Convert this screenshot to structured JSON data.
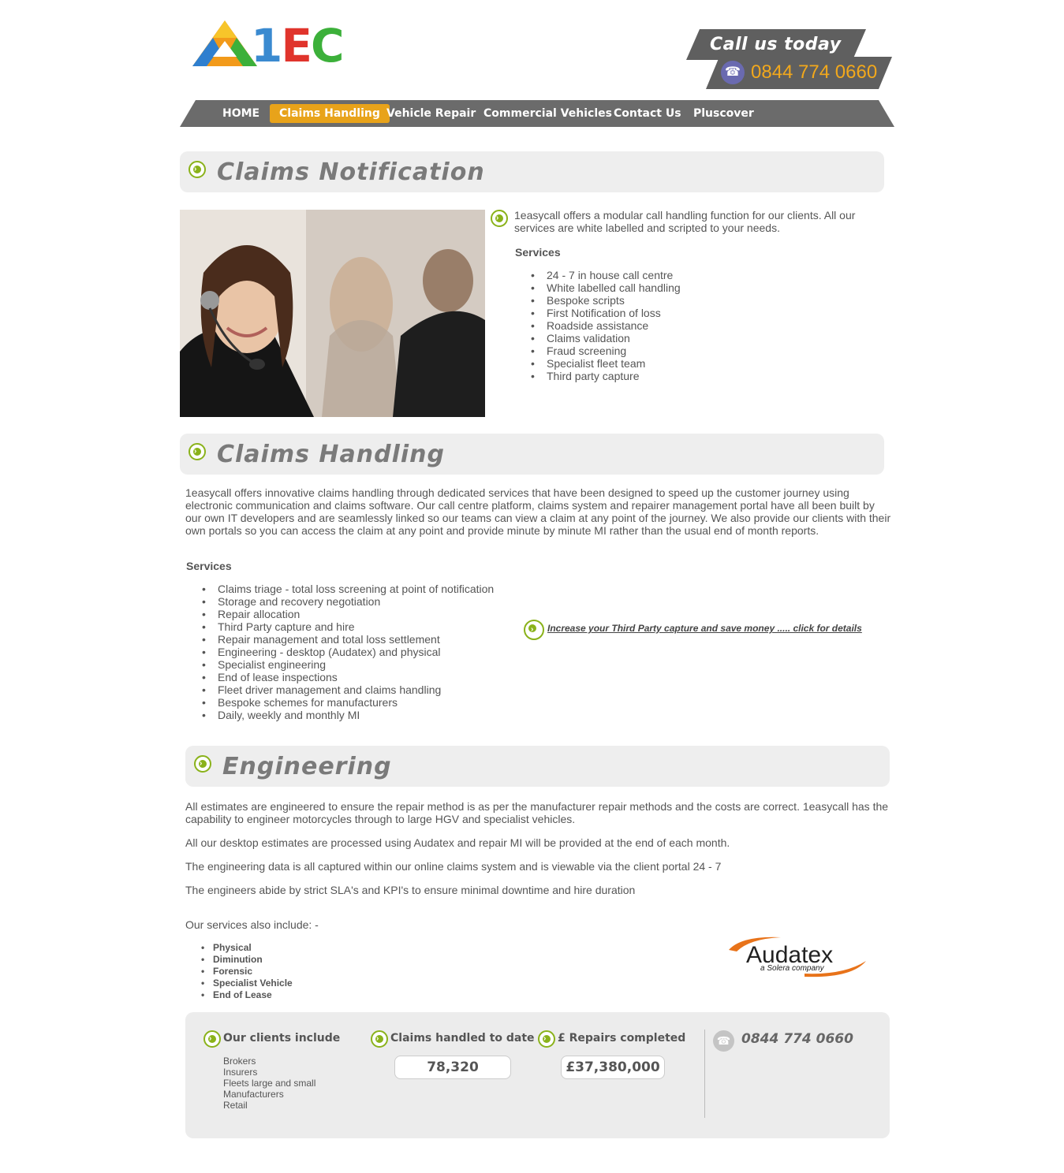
{
  "header": {
    "logo_text": {
      "one": "1",
      "e": "E",
      "c": "C"
    },
    "call_label": "Call us today",
    "phone": "0844 774 0660"
  },
  "nav": {
    "items": [
      {
        "label": "HOME"
      },
      {
        "label": "Claims Handling",
        "active": true
      },
      {
        "label": "Vehicle Repair"
      },
      {
        "label": "Commercial Vehicles"
      },
      {
        "label": "Contact Us"
      },
      {
        "label": "Pluscover"
      }
    ]
  },
  "claims_notification": {
    "title": "Claims Notification",
    "intro": "1easycall offers a modular call handling function for our clients. All our services are white labelled and scripted to your needs.",
    "services_label": "Services",
    "services": [
      "24 - 7 in house call centre",
      "White labelled call handling",
      "Bespoke scripts",
      "First Notification of loss",
      "Roadside assistance",
      "Claims validation",
      "Fraud screening",
      "Specialist fleet team",
      "Third party capture"
    ]
  },
  "claims_handling": {
    "title": "Claims Handling",
    "body": "1easycall offers innovative claims handling through dedicated services that have been designed to speed up the customer journey using electronic communication and claims software. Our call centre platform, claims system and repairer management portal have all been built by our own IT developers and are seamlessly linked so our teams can view a claim at any point of the journey. We also provide our clients with their own portals so you can access the claim at any point and provide minute by minute MI rather than the usual end of month reports.",
    "services_label": "Services",
    "services": [
      "Claims triage - total loss screening at point of notification",
      "Storage and recovery negotiation",
      "Repair allocation",
      "Third Party capture and hire",
      "Repair management and total loss settlement",
      "Engineering - desktop (Audatex) and physical",
      "Specialist engineering",
      "End of lease inspections",
      "Fleet driver management and claims handling",
      "Bespoke schemes for manufacturers",
      "Daily, weekly and monthly MI"
    ],
    "link": "Increase your Third Party capture and save money ..... click for details"
  },
  "engineering": {
    "title": "Engineering",
    "paragraphs": [
      "All estimates are engineered to ensure the repair method is as per the manufacturer repair methods and the costs are correct. 1easycall has the capability to engineer motorcycles through to large HGV and specialist vehicles.",
      "All our desktop estimates are processed using Audatex and repair MI will be provided at the end of each month.",
      "The engineering data is all captured within our online claims system and is viewable via the client portal 24 - 7",
      "The engineers abide by strict SLA's and KPI's to ensure minimal downtime and hire duration"
    ],
    "also_label": "Our services also include: -",
    "also": [
      "Physical",
      "Diminution",
      "Forensic",
      "Specialist Vehicle",
      "End of Lease"
    ],
    "audatex_logo": {
      "name": "Audatex",
      "tagline": "a Solera company"
    }
  },
  "footer": {
    "clients_label": "Our clients include",
    "clients": [
      "Brokers",
      "Insurers",
      "Fleets large and small",
      "Manufacturers",
      "Retail"
    ],
    "claims_label": "Claims handled to date",
    "claims_value": "78,320",
    "repairs_label": "£ Repairs completed",
    "repairs_value": "£37,380,000",
    "phone": "0844 774 0660"
  },
  "colors": {
    "accent_green": "#8ab21a",
    "nav_active": "#e8a31a",
    "phone_orange": "#f2a81c",
    "nav_bg": "#6b6b6b"
  },
  "icons": [
    "arrow-circle-icon",
    "phone-icon"
  ]
}
